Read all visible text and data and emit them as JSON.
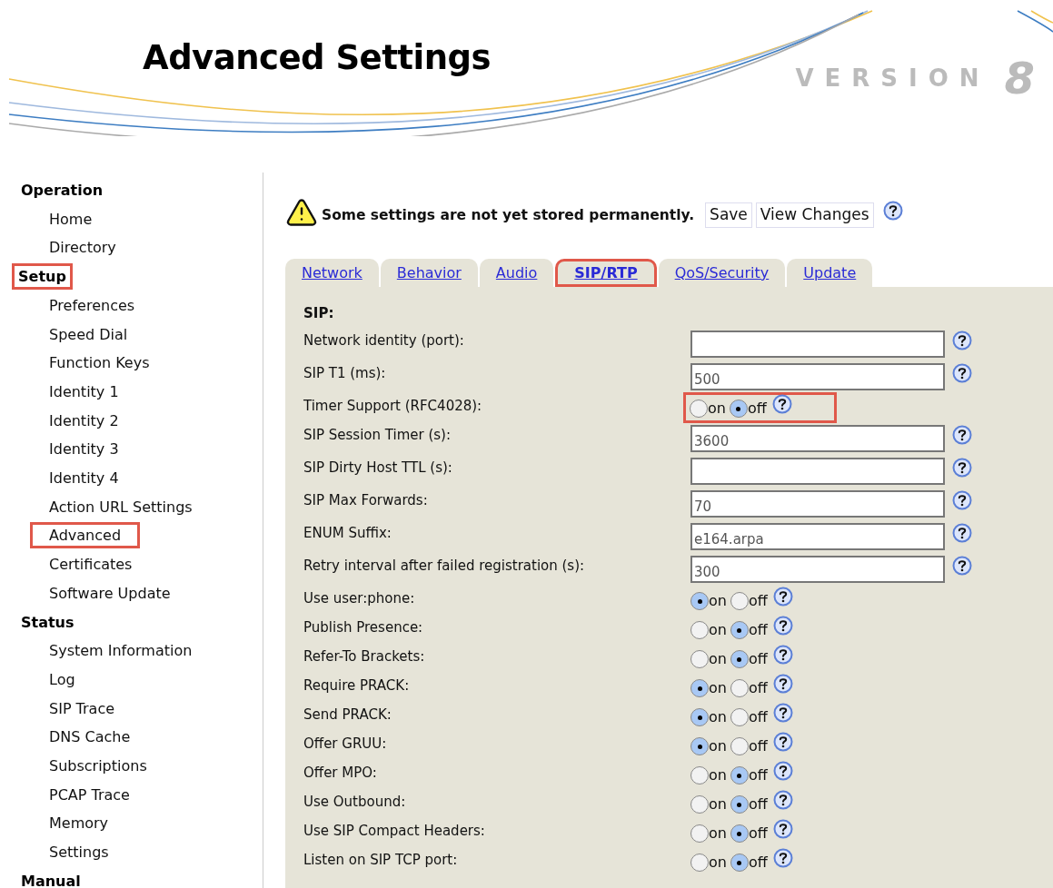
{
  "header": {
    "title": "Advanced Settings",
    "version_word": "VERSION",
    "version_number": "8"
  },
  "sidebar": {
    "sections": [
      {
        "title": "Operation",
        "highlighted": false,
        "items": [
          {
            "label": "Home",
            "highlighted": false
          },
          {
            "label": "Directory",
            "highlighted": false
          }
        ]
      },
      {
        "title": "Setup",
        "highlighted": true,
        "items": [
          {
            "label": "Preferences",
            "highlighted": false
          },
          {
            "label": "Speed Dial",
            "highlighted": false
          },
          {
            "label": "Function Keys",
            "highlighted": false
          },
          {
            "label": "Identity 1",
            "highlighted": false
          },
          {
            "label": "Identity 2",
            "highlighted": false
          },
          {
            "label": "Identity 3",
            "highlighted": false
          },
          {
            "label": "Identity 4",
            "highlighted": false
          },
          {
            "label": "Action URL Settings",
            "highlighted": false
          },
          {
            "label": "Advanced",
            "highlighted": true
          },
          {
            "label": "Certificates",
            "highlighted": false
          },
          {
            "label": "Software Update",
            "highlighted": false
          }
        ]
      },
      {
        "title": "Status",
        "highlighted": false,
        "items": [
          {
            "label": "System Information",
            "highlighted": false
          },
          {
            "label": "Log",
            "highlighted": false
          },
          {
            "label": "SIP Trace",
            "highlighted": false
          },
          {
            "label": "DNS Cache",
            "highlighted": false
          },
          {
            "label": "Subscriptions",
            "highlighted": false
          },
          {
            "label": "PCAP Trace",
            "highlighted": false
          },
          {
            "label": "Memory",
            "highlighted": false
          },
          {
            "label": "Settings",
            "highlighted": false
          }
        ]
      },
      {
        "title": "Manual",
        "highlighted": false
      }
    ]
  },
  "notice": {
    "message": "Some settings are not yet stored permanently.",
    "buttons": [
      "Save",
      "View Changes"
    ]
  },
  "tabs": [
    {
      "label": "Network",
      "selected": false,
      "highlighted": false
    },
    {
      "label": "Behavior",
      "selected": false,
      "highlighted": false
    },
    {
      "label": "Audio",
      "selected": false,
      "highlighted": false
    },
    {
      "label": "SIP/RTP",
      "selected": true,
      "highlighted": true
    },
    {
      "label": "QoS/Security",
      "selected": false,
      "highlighted": false
    },
    {
      "label": "Update",
      "selected": false,
      "highlighted": false
    }
  ],
  "section_title": "SIP:",
  "settings": [
    {
      "label": "Network identity (port):",
      "kind": "text"
    },
    {
      "label": "SIP T1 (ms):",
      "kind": "text",
      "value": "500"
    },
    {
      "label": "Timer Support (RFC4028):",
      "kind": "radio",
      "highlighted": true,
      "options": [
        {
          "label": "on",
          "selected": false
        },
        {
          "label": "off",
          "selected": true
        }
      ]
    },
    {
      "label": "SIP Session Timer (s):",
      "kind": "text",
      "value": "3600"
    },
    {
      "label": "SIP Dirty Host TTL (s):",
      "kind": "text"
    },
    {
      "label": "SIP Max Forwards:",
      "kind": "text",
      "value": "70"
    },
    {
      "label": "ENUM Suffix:",
      "kind": "text",
      "value": "e164.arpa"
    },
    {
      "label": "Retry interval after failed registration (s):",
      "kind": "text",
      "value": "300"
    },
    {
      "label": "Use user:phone:",
      "kind": "radio",
      "highlighted": false,
      "options": [
        {
          "label": "on",
          "selected": true
        },
        {
          "label": "off",
          "selected": false
        }
      ]
    },
    {
      "label": "Publish Presence:",
      "kind": "radio",
      "highlighted": false,
      "options": [
        {
          "label": "on",
          "selected": false
        },
        {
          "label": "off",
          "selected": true
        }
      ]
    },
    {
      "label": "Refer-To Brackets:",
      "kind": "radio",
      "highlighted": false,
      "options": [
        {
          "label": "on",
          "selected": false
        },
        {
          "label": "off",
          "selected": true
        }
      ]
    },
    {
      "label": "Require PRACK:",
      "kind": "radio",
      "highlighted": false,
      "options": [
        {
          "label": "on",
          "selected": true
        },
        {
          "label": "off",
          "selected": false
        }
      ]
    },
    {
      "label": "Send PRACK:",
      "kind": "radio",
      "highlighted": false,
      "options": [
        {
          "label": "on",
          "selected": true
        },
        {
          "label": "off",
          "selected": false
        }
      ]
    },
    {
      "label": "Offer GRUU:",
      "kind": "radio",
      "highlighted": false,
      "options": [
        {
          "label": "on",
          "selected": true
        },
        {
          "label": "off",
          "selected": false
        }
      ]
    },
    {
      "label": "Offer MPO:",
      "kind": "radio",
      "highlighted": false,
      "options": [
        {
          "label": "on",
          "selected": false
        },
        {
          "label": "off",
          "selected": true
        }
      ]
    },
    {
      "label": "Use Outbound:",
      "kind": "radio",
      "highlighted": false,
      "options": [
        {
          "label": "on",
          "selected": false
        },
        {
          "label": "off",
          "selected": true
        }
      ]
    },
    {
      "label": "Use SIP Compact Headers:",
      "kind": "radio",
      "highlighted": false,
      "options": [
        {
          "label": "on",
          "selected": false
        },
        {
          "label": "off",
          "selected": true
        }
      ]
    },
    {
      "label": "Listen on SIP TCP port:",
      "kind": "radio",
      "highlighted": false,
      "options": [
        {
          "label": "on",
          "selected": false
        },
        {
          "label": "off",
          "selected": true
        }
      ]
    }
  ]
}
